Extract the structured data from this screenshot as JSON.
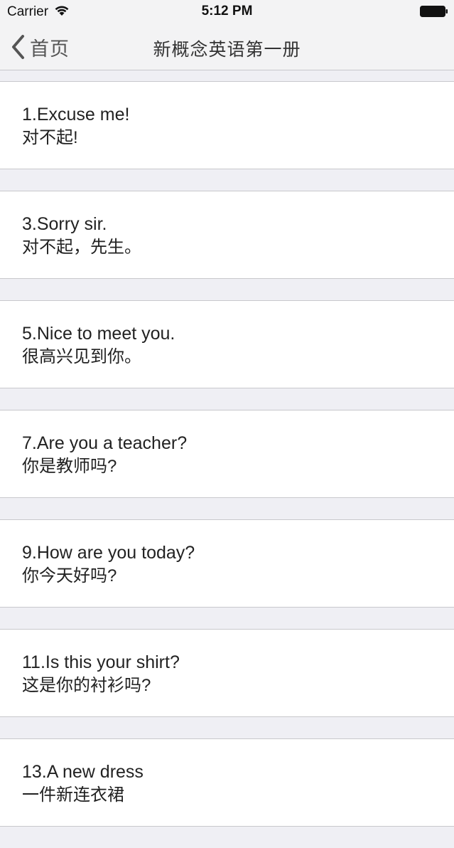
{
  "status_bar": {
    "carrier": "Carrier",
    "time": "5:12 PM",
    "wifi_icon": "wifi-icon",
    "battery_icon": "battery-icon"
  },
  "nav": {
    "back_label": "首页",
    "back_icon": "chevron-left-icon",
    "title": "新概念英语第一册",
    "accent_color": "#555555"
  },
  "lessons": [
    {
      "en": "1.Excuse me!",
      "cn": "对不起!"
    },
    {
      "en": "3.Sorry sir.",
      "cn": "对不起，先生。"
    },
    {
      "en": "5.Nice to meet you.",
      "cn": "很高兴见到你。"
    },
    {
      "en": "7.Are you a teacher?",
      "cn": "你是教师吗?"
    },
    {
      "en": "9.How are you today?",
      "cn": "你今天好吗?"
    },
    {
      "en": "11.Is this your shirt?",
      "cn": "这是你的衬衫吗?"
    },
    {
      "en": "13.A new dress",
      "cn": "一件新连衣裙"
    }
  ]
}
